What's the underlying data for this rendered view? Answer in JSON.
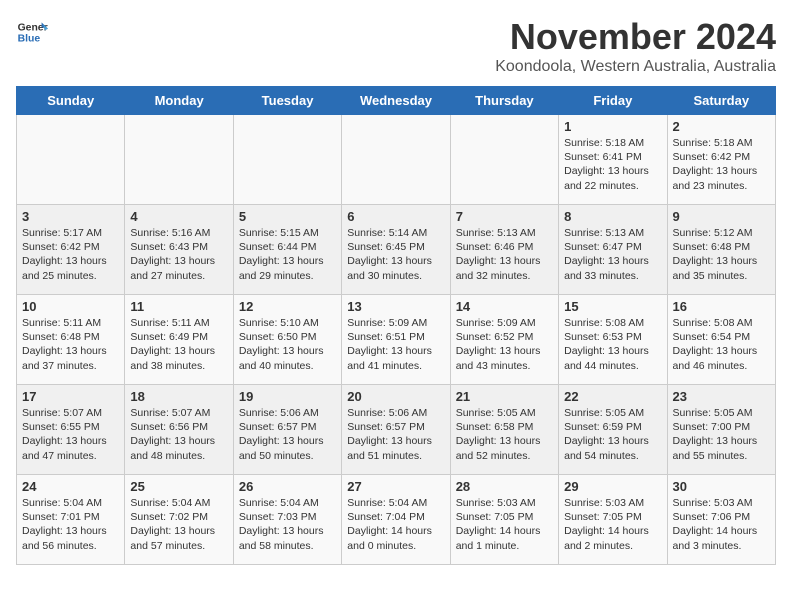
{
  "header": {
    "logo_general": "General",
    "logo_blue": "Blue",
    "title": "November 2024",
    "subtitle": "Koondoola, Western Australia, Australia"
  },
  "days_of_week": [
    "Sunday",
    "Monday",
    "Tuesday",
    "Wednesday",
    "Thursday",
    "Friday",
    "Saturday"
  ],
  "weeks": [
    {
      "cells": [
        {
          "day": "",
          "empty": true
        },
        {
          "day": "",
          "empty": true
        },
        {
          "day": "",
          "empty": true
        },
        {
          "day": "",
          "empty": true
        },
        {
          "day": "",
          "empty": true
        },
        {
          "day": "1",
          "sunrise": "Sunrise: 5:18 AM",
          "sunset": "Sunset: 6:41 PM",
          "daylight": "Daylight: 13 hours and 22 minutes."
        },
        {
          "day": "2",
          "sunrise": "Sunrise: 5:18 AM",
          "sunset": "Sunset: 6:42 PM",
          "daylight": "Daylight: 13 hours and 23 minutes."
        }
      ]
    },
    {
      "cells": [
        {
          "day": "3",
          "sunrise": "Sunrise: 5:17 AM",
          "sunset": "Sunset: 6:42 PM",
          "daylight": "Daylight: 13 hours and 25 minutes."
        },
        {
          "day": "4",
          "sunrise": "Sunrise: 5:16 AM",
          "sunset": "Sunset: 6:43 PM",
          "daylight": "Daylight: 13 hours and 27 minutes."
        },
        {
          "day": "5",
          "sunrise": "Sunrise: 5:15 AM",
          "sunset": "Sunset: 6:44 PM",
          "daylight": "Daylight: 13 hours and 29 minutes."
        },
        {
          "day": "6",
          "sunrise": "Sunrise: 5:14 AM",
          "sunset": "Sunset: 6:45 PM",
          "daylight": "Daylight: 13 hours and 30 minutes."
        },
        {
          "day": "7",
          "sunrise": "Sunrise: 5:13 AM",
          "sunset": "Sunset: 6:46 PM",
          "daylight": "Daylight: 13 hours and 32 minutes."
        },
        {
          "day": "8",
          "sunrise": "Sunrise: 5:13 AM",
          "sunset": "Sunset: 6:47 PM",
          "daylight": "Daylight: 13 hours and 33 minutes."
        },
        {
          "day": "9",
          "sunrise": "Sunrise: 5:12 AM",
          "sunset": "Sunset: 6:48 PM",
          "daylight": "Daylight: 13 hours and 35 minutes."
        }
      ]
    },
    {
      "cells": [
        {
          "day": "10",
          "sunrise": "Sunrise: 5:11 AM",
          "sunset": "Sunset: 6:48 PM",
          "daylight": "Daylight: 13 hours and 37 minutes."
        },
        {
          "day": "11",
          "sunrise": "Sunrise: 5:11 AM",
          "sunset": "Sunset: 6:49 PM",
          "daylight": "Daylight: 13 hours and 38 minutes."
        },
        {
          "day": "12",
          "sunrise": "Sunrise: 5:10 AM",
          "sunset": "Sunset: 6:50 PM",
          "daylight": "Daylight: 13 hours and 40 minutes."
        },
        {
          "day": "13",
          "sunrise": "Sunrise: 5:09 AM",
          "sunset": "Sunset: 6:51 PM",
          "daylight": "Daylight: 13 hours and 41 minutes."
        },
        {
          "day": "14",
          "sunrise": "Sunrise: 5:09 AM",
          "sunset": "Sunset: 6:52 PM",
          "daylight": "Daylight: 13 hours and 43 minutes."
        },
        {
          "day": "15",
          "sunrise": "Sunrise: 5:08 AM",
          "sunset": "Sunset: 6:53 PM",
          "daylight": "Daylight: 13 hours and 44 minutes."
        },
        {
          "day": "16",
          "sunrise": "Sunrise: 5:08 AM",
          "sunset": "Sunset: 6:54 PM",
          "daylight": "Daylight: 13 hours and 46 minutes."
        }
      ]
    },
    {
      "cells": [
        {
          "day": "17",
          "sunrise": "Sunrise: 5:07 AM",
          "sunset": "Sunset: 6:55 PM",
          "daylight": "Daylight: 13 hours and 47 minutes."
        },
        {
          "day": "18",
          "sunrise": "Sunrise: 5:07 AM",
          "sunset": "Sunset: 6:56 PM",
          "daylight": "Daylight: 13 hours and 48 minutes."
        },
        {
          "day": "19",
          "sunrise": "Sunrise: 5:06 AM",
          "sunset": "Sunset: 6:57 PM",
          "daylight": "Daylight: 13 hours and 50 minutes."
        },
        {
          "day": "20",
          "sunrise": "Sunrise: 5:06 AM",
          "sunset": "Sunset: 6:57 PM",
          "daylight": "Daylight: 13 hours and 51 minutes."
        },
        {
          "day": "21",
          "sunrise": "Sunrise: 5:05 AM",
          "sunset": "Sunset: 6:58 PM",
          "daylight": "Daylight: 13 hours and 52 minutes."
        },
        {
          "day": "22",
          "sunrise": "Sunrise: 5:05 AM",
          "sunset": "Sunset: 6:59 PM",
          "daylight": "Daylight: 13 hours and 54 minutes."
        },
        {
          "day": "23",
          "sunrise": "Sunrise: 5:05 AM",
          "sunset": "Sunset: 7:00 PM",
          "daylight": "Daylight: 13 hours and 55 minutes."
        }
      ]
    },
    {
      "cells": [
        {
          "day": "24",
          "sunrise": "Sunrise: 5:04 AM",
          "sunset": "Sunset: 7:01 PM",
          "daylight": "Daylight: 13 hours and 56 minutes."
        },
        {
          "day": "25",
          "sunrise": "Sunrise: 5:04 AM",
          "sunset": "Sunset: 7:02 PM",
          "daylight": "Daylight: 13 hours and 57 minutes."
        },
        {
          "day": "26",
          "sunrise": "Sunrise: 5:04 AM",
          "sunset": "Sunset: 7:03 PM",
          "daylight": "Daylight: 13 hours and 58 minutes."
        },
        {
          "day": "27",
          "sunrise": "Sunrise: 5:04 AM",
          "sunset": "Sunset: 7:04 PM",
          "daylight": "Daylight: 14 hours and 0 minutes."
        },
        {
          "day": "28",
          "sunrise": "Sunrise: 5:03 AM",
          "sunset": "Sunset: 7:05 PM",
          "daylight": "Daylight: 14 hours and 1 minute."
        },
        {
          "day": "29",
          "sunrise": "Sunrise: 5:03 AM",
          "sunset": "Sunset: 7:05 PM",
          "daylight": "Daylight: 14 hours and 2 minutes."
        },
        {
          "day": "30",
          "sunrise": "Sunrise: 5:03 AM",
          "sunset": "Sunset: 7:06 PM",
          "daylight": "Daylight: 14 hours and 3 minutes."
        }
      ]
    }
  ]
}
